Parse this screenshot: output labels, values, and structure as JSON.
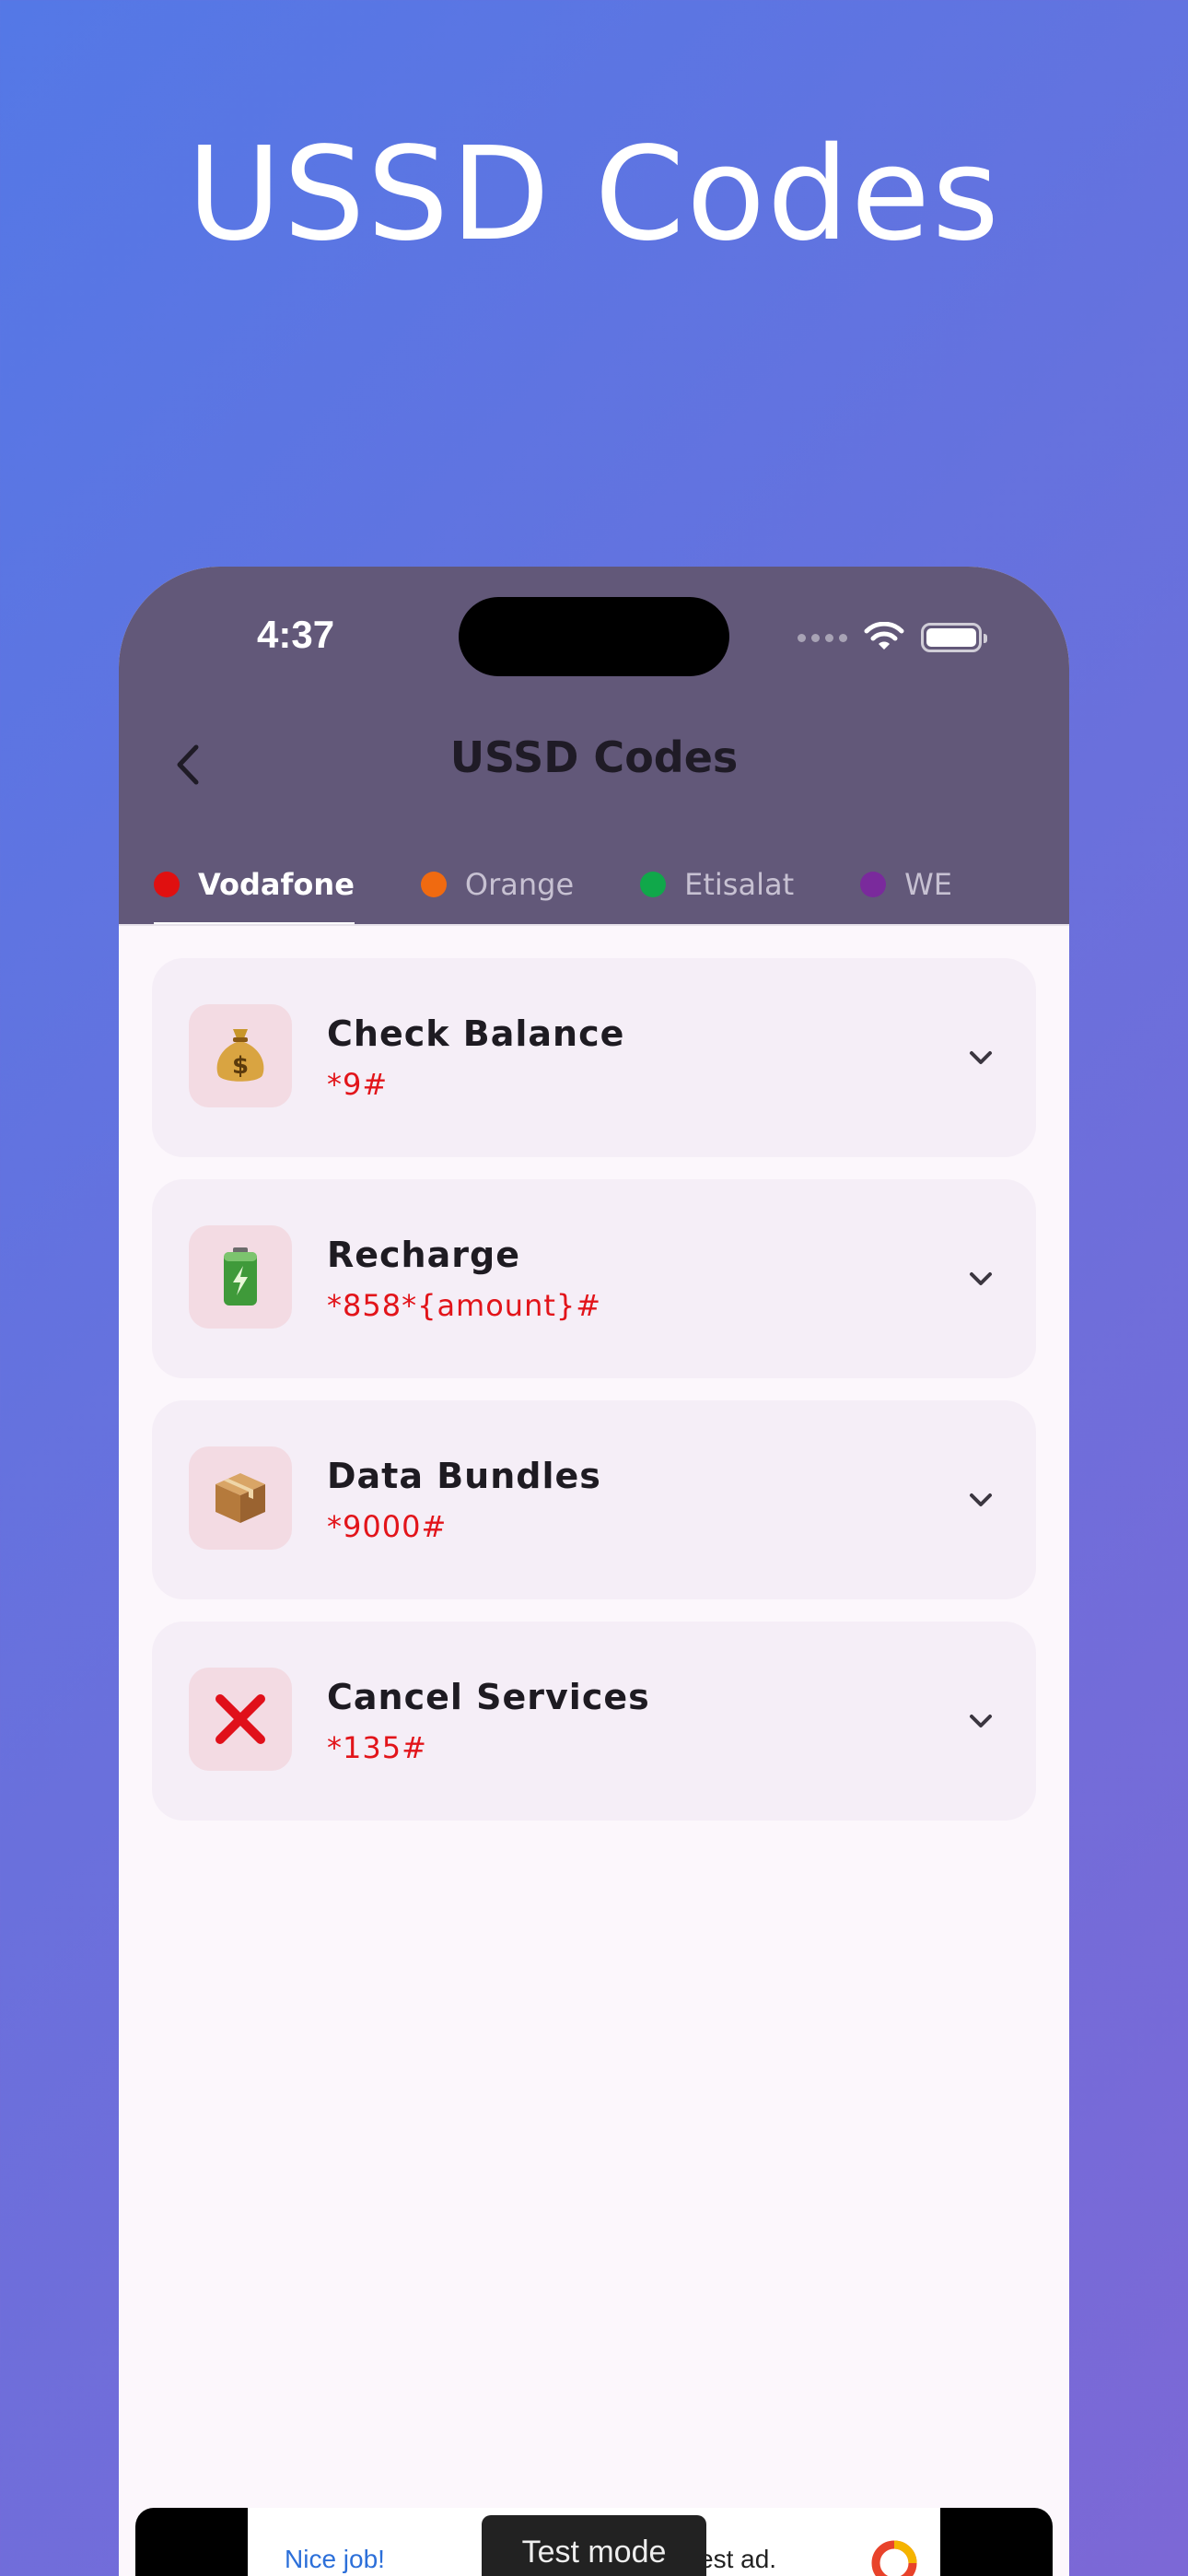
{
  "hero": {
    "title": "USSD Codes"
  },
  "status_bar": {
    "time": "4:37"
  },
  "app_bar": {
    "title": "USSD Codes"
  },
  "tabs": [
    {
      "label": "Vodafone",
      "color": "#e01010",
      "active": true
    },
    {
      "label": "Orange",
      "color": "#f06a10",
      "active": false
    },
    {
      "label": "Etisalat",
      "color": "#10a84a",
      "active": false
    },
    {
      "label": "WE",
      "color": "#7a2a9c",
      "active": false
    }
  ],
  "items": [
    {
      "title": "Check Balance",
      "code": "*9#",
      "icon": "money-bag-icon",
      "emoji": "💰"
    },
    {
      "title": "Recharge",
      "code": "*858*{amount}#",
      "icon": "battery-icon",
      "emoji": "🔋"
    },
    {
      "title": "Data Bundles",
      "code": "*9000#",
      "icon": "package-icon",
      "emoji": "📦"
    },
    {
      "title": "Cancel Services",
      "code": "*135#",
      "icon": "cross-mark-icon",
      "emoji": "❌"
    }
  ],
  "ad": {
    "left_text": "Nice job!",
    "right_text": "est ad.",
    "badge": "Test mode"
  },
  "colors": {
    "accent_code": "#e2141a",
    "header_bg": "#625879",
    "page_bg": "#fcf7fc"
  }
}
